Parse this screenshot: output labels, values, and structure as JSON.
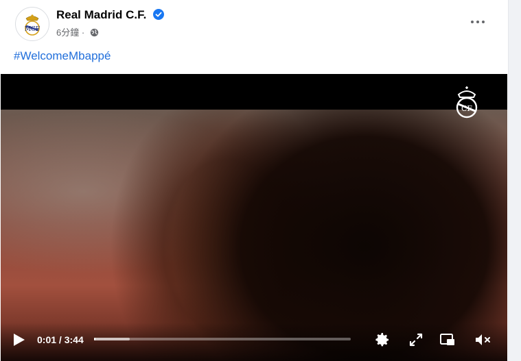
{
  "post": {
    "page_name": "Real Madrid C.F.",
    "timestamp": "6分鐘",
    "separator": "·",
    "privacy_icon": "globe-icon",
    "verified_icon": "verified-badge-icon",
    "more_icon": "more-options-icon",
    "hashtag": "#WelcomeMbappé"
  },
  "video": {
    "current_time": "0:01",
    "time_separator": " / ",
    "duration": "3:44",
    "progress": 0.0045,
    "buffered": 0.14,
    "icons": {
      "play": "play-icon",
      "settings": "settings-gear-icon",
      "fullscreen": "fullscreen-icon",
      "pip": "picture-in-picture-icon",
      "mute": "volume-muted-icon"
    }
  },
  "colors": {
    "brand_blue": "#216fdb",
    "verified_blue": "#1877f2",
    "text_primary": "#050505",
    "text_secondary": "#65676b"
  }
}
